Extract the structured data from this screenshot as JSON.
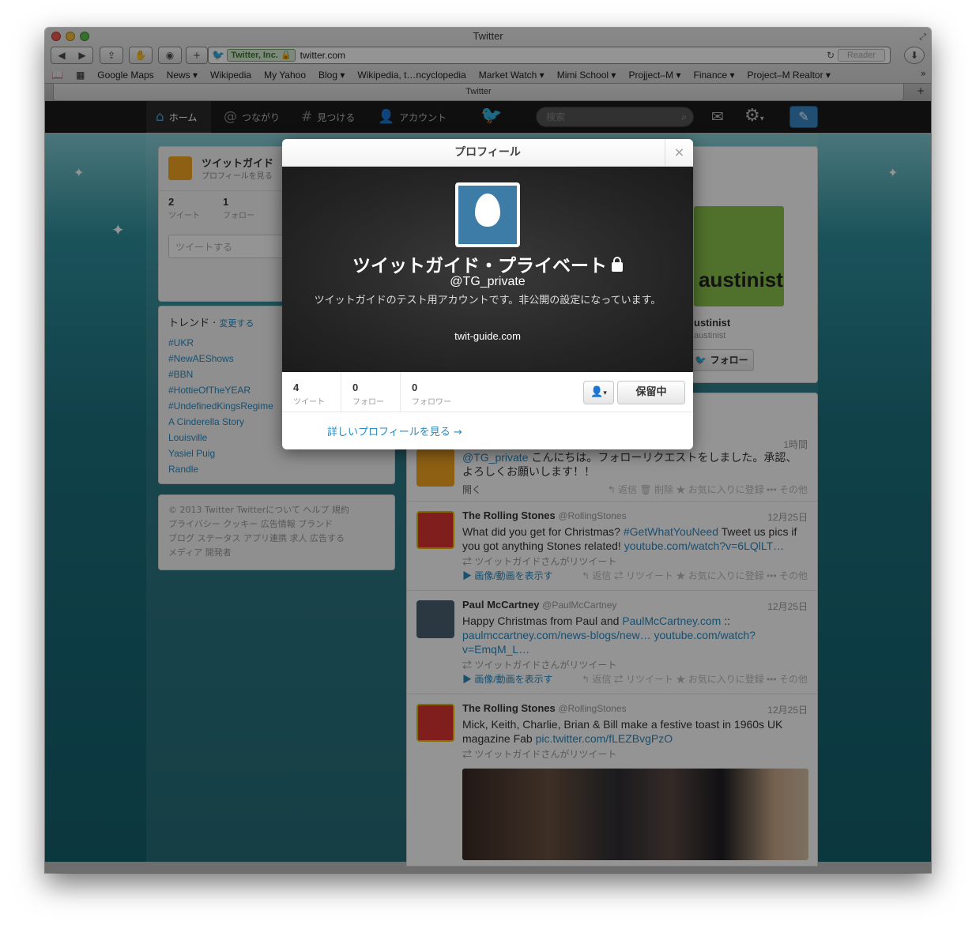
{
  "window": {
    "title": "Twitter"
  },
  "browser": {
    "ev_label": "Twitter, Inc.",
    "url": "twitter.com",
    "reader": "Reader",
    "tab_title": "Twitter",
    "bookmarks": [
      "Google Maps",
      "News ▾",
      "Wikipedia",
      "My Yahoo",
      "Blog ▾",
      "Wikipedia, t…ncyclopedia",
      "Market Watch ▾",
      "Mimi School ▾",
      "Projject–M ▾",
      "Finance ▾",
      "Project–M Realtor ▾"
    ]
  },
  "topnav": {
    "home": "ホーム",
    "connect": "つながり",
    "discover": "見つける",
    "account": "アカウント",
    "search_placeholder": "検索"
  },
  "dashboard": {
    "name": "ツイットガイド",
    "view_profile": "プロフィールを見る",
    "tweets_count": "2",
    "tweets_label": "ツイート",
    "following_count": "1",
    "following_label": "フォロー",
    "compose_placeholder": "ツイートする"
  },
  "trends": {
    "title": "トレンド",
    "change": "変更する",
    "items": [
      "#UKR",
      "#NewAEShows",
      "#BBN",
      "#HottieOfTheYEAR",
      "#UndefinedKingsRegime",
      "A Cinderella Story",
      "Louisville",
      "Yasiel Puig",
      "Randle"
    ]
  },
  "footer": {
    "line1": "© 2013 Twitter  Twitterについて  ヘルプ  規約",
    "line2": "プライバシー  クッキー  広告情報  ブランド",
    "line3": "ブログ  ステータス  アプリ連携  求人  広告する",
    "line4": "メディア  開発者"
  },
  "who_to_follow": {
    "name": "ustinist",
    "handle": "austinist",
    "logo_text": "austinist",
    "follow": "フォロー"
  },
  "tweets": [
    {
      "time": "1時間",
      "mention": "@TG_private",
      "text": " こんにちは。フォローリクエストをしました。承認、よろしくお願いします！！",
      "open": "開く",
      "actions": "↰ 返信  🗑 削除  ★ お気に入りに登録  ••• その他"
    },
    {
      "name": "The Rolling Stones",
      "handle": "@RollingStones",
      "time": "12月25日",
      "text_a": "What did you get for Christmas? ",
      "hashtag": "#GetWhatYouNeed",
      "text_b": " Tweet us pics if you got anything Stones related! ",
      "link": "youtube.com/watch?v=6LQlLT…",
      "retweeted_by": "ツイットガイドさんがリツイート",
      "media": "画像/動画を表示す",
      "actions": "↰ 返信  ⇄ リツイート  ★ お気に入りに登録  ••• その他"
    },
    {
      "name": "Paul McCartney",
      "handle": "@PaulMcCartney",
      "time": "12月25日",
      "text_a": "Happy Christmas from Paul and ",
      "link_a": "PaulMcCartney.com",
      "text_b": " :: ",
      "link_b": "paulmccartney.com/news-blogs/new… youtube.com/watch?v=EmqM_L…",
      "retweeted_by": "ツイットガイドさんがリツイート",
      "media": "画像/動画を表示す",
      "actions": "↰ 返信  ⇄ リツイート  ★ お気に入りに登録  ••• その他"
    },
    {
      "name": "The Rolling Stones",
      "handle": "@RollingStones",
      "time": "12月25日",
      "text_a": "Mick, Keith, Charlie, Brian & Bill make a festive toast in 1960s UK magazine Fab ",
      "link": "pic.twitter.com/fLEZBvgPzO",
      "retweeted_by": "ツイットガイドさんがリツイート"
    }
  ],
  "modal": {
    "title": "プロフィール",
    "name": "ツイットガイド・プライベート",
    "handle": "@TG_private",
    "bio": "ツイットガイドのテスト用アカウントです。非公開の設定になっています。",
    "url": "twit-guide.com",
    "tweets_count": "4",
    "tweets_label": "ツイート",
    "following_count": "0",
    "following_label": "フォロー",
    "followers_count": "0",
    "followers_label": "フォロワー",
    "pending": "保留中",
    "more_profile": "詳しいプロフィールを見る →"
  }
}
